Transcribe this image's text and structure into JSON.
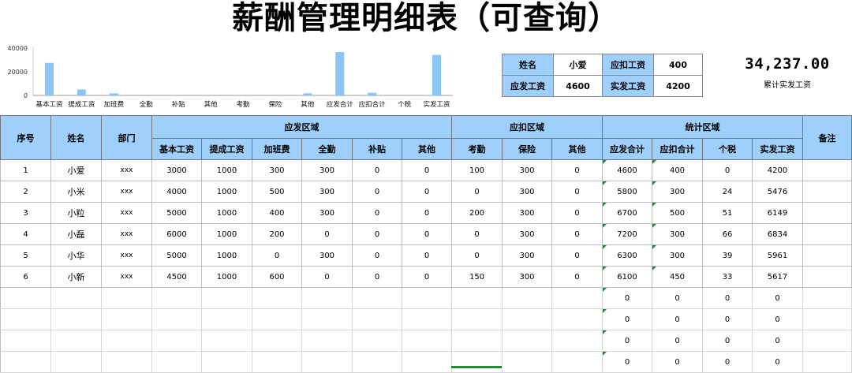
{
  "title": "薪酬管理明细表（可查询）",
  "chart_data": {
    "type": "bar",
    "categories": [
      "基本工资",
      "提成工资",
      "加班费",
      "全勤",
      "补贴",
      "其他",
      "考勤",
      "保险",
      "其他",
      "应发合计",
      "应扣合计",
      "个税",
      "实发工资"
    ],
    "values": [
      27500,
      5000,
      1800,
      0,
      0,
      0,
      0,
      0,
      1800,
      36700,
      2250,
      0,
      34237
    ],
    "yticks": [
      "0",
      "20000",
      "40000"
    ],
    "ylim": [
      0,
      40000
    ],
    "color": "#8cc4f7"
  },
  "query": {
    "name_label": "姓名",
    "name_value": "小爱",
    "deduct_label": "应扣工资",
    "deduct_value": "400",
    "gross_label": "应发工资",
    "gross_value": "4600",
    "net_label": "实发工资",
    "net_value": "4200"
  },
  "total": {
    "value": "34,237.00",
    "label": "累计实发工资"
  },
  "table": {
    "headers": {
      "no": "序号",
      "name": "姓名",
      "dept": "部门",
      "remark": "备注",
      "group_pay": "应发区域",
      "group_deduct": "应扣区域",
      "group_stat": "统计区域",
      "base": "基本工资",
      "commission": "提成工资",
      "overtime": "加班费",
      "attendance_bonus": "全勤",
      "allowance": "补贴",
      "other1": "其他",
      "absence": "考勤",
      "insurance": "保险",
      "other2": "其他",
      "gross": "应发合计",
      "deduct": "应扣合计",
      "tax": "个税",
      "net": "实发工资"
    },
    "rows": [
      [
        "1",
        "小爱",
        "xxx",
        "3000",
        "1000",
        "300",
        "300",
        "0",
        "0",
        "100",
        "300",
        "0",
        "4600",
        "400",
        "0",
        "4200",
        ""
      ],
      [
        "2",
        "小米",
        "xxx",
        "4000",
        "1000",
        "500",
        "300",
        "0",
        "0",
        "0",
        "300",
        "0",
        "5800",
        "300",
        "24",
        "5476",
        ""
      ],
      [
        "3",
        "小粒",
        "xxx",
        "5000",
        "1000",
        "400",
        "300",
        "0",
        "0",
        "200",
        "300",
        "0",
        "6700",
        "500",
        "51",
        "6149",
        ""
      ],
      [
        "4",
        "小磊",
        "xxx",
        "6000",
        "1000",
        "200",
        "0",
        "0",
        "0",
        "0",
        "300",
        "0",
        "7200",
        "300",
        "66",
        "6834",
        ""
      ],
      [
        "5",
        "小华",
        "xxx",
        "5000",
        "1000",
        "0",
        "300",
        "0",
        "0",
        "0",
        "300",
        "0",
        "6300",
        "300",
        "39",
        "5961",
        ""
      ],
      [
        "6",
        "小新",
        "xxx",
        "4500",
        "1000",
        "600",
        "0",
        "0",
        "0",
        "150",
        "300",
        "0",
        "6100",
        "450",
        "33",
        "5617",
        ""
      ],
      [
        "",
        "",
        "",
        "",
        "",
        "",
        "",
        "",
        "",
        "",
        "",
        "",
        "0",
        "0",
        "0",
        "0",
        ""
      ],
      [
        "",
        "",
        "",
        "",
        "",
        "",
        "",
        "",
        "",
        "",
        "",
        "",
        "0",
        "0",
        "0",
        "0",
        ""
      ],
      [
        "",
        "",
        "",
        "",
        "",
        "",
        "",
        "",
        "",
        "",
        "",
        "",
        "0",
        "0",
        "0",
        "0",
        ""
      ],
      [
        "",
        "",
        "",
        "",
        "",
        "",
        "",
        "",
        "",
        "",
        "",
        "",
        "0",
        "0",
        "0",
        "0",
        ""
      ]
    ]
  }
}
